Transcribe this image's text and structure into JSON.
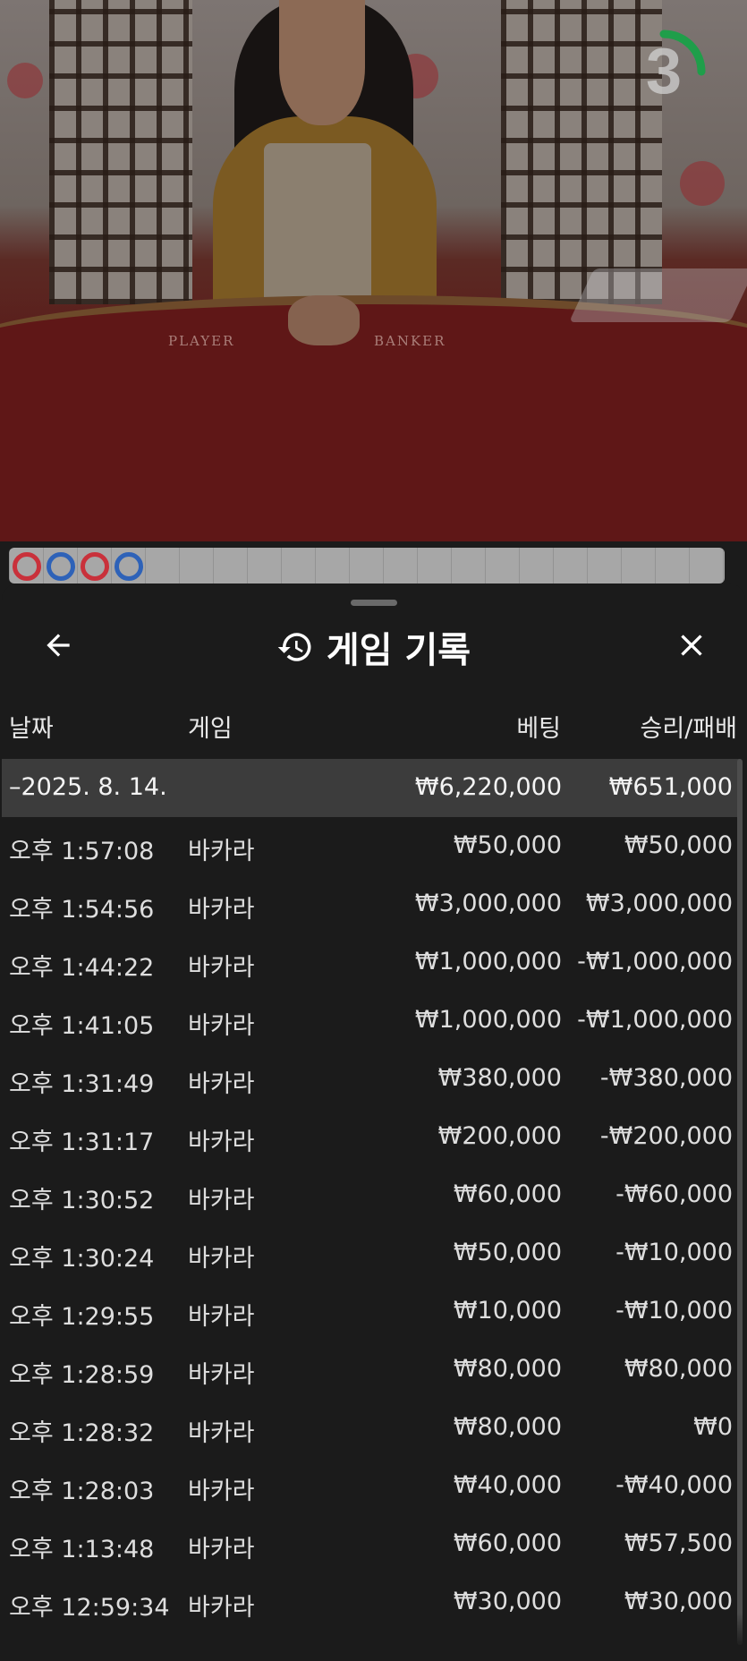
{
  "video": {
    "table_labels": [
      "PLAYER",
      "BANKER"
    ],
    "countdown": "3",
    "countdown_color": "#1f9e4a"
  },
  "road": {
    "beads": [
      "banker",
      "player",
      "banker",
      "player"
    ],
    "colors": {
      "banker": "#c9313b",
      "player": "#2e62b8"
    }
  },
  "history": {
    "title": "게임 기록",
    "icons": {
      "back": "arrow-left-icon",
      "title": "history-clock-icon",
      "close": "close-x-icon"
    },
    "columns": {
      "date": "날짜",
      "game": "게임",
      "bet": "베팅",
      "result": "승리/패배"
    },
    "summary": {
      "date": "–2025. 8. 14.",
      "bet": "₩6,220,000",
      "result": "₩651,000"
    },
    "rows": [
      {
        "time": "오후 1:57:08",
        "game": "바카라",
        "bet": "₩50,000",
        "result": "₩50,000"
      },
      {
        "time": "오후 1:54:56",
        "game": "바카라",
        "bet": "₩3,000,000",
        "result": "₩3,000,000"
      },
      {
        "time": "오후 1:44:22",
        "game": "바카라",
        "bet": "₩1,000,000",
        "result": "-₩1,000,000"
      },
      {
        "time": "오후 1:41:05",
        "game": "바카라",
        "bet": "₩1,000,000",
        "result": "-₩1,000,000"
      },
      {
        "time": "오후 1:31:49",
        "game": "바카라",
        "bet": "₩380,000",
        "result": "-₩380,000"
      },
      {
        "time": "오후 1:31:17",
        "game": "바카라",
        "bet": "₩200,000",
        "result": "-₩200,000"
      },
      {
        "time": "오후 1:30:52",
        "game": "바카라",
        "bet": "₩60,000",
        "result": "-₩60,000"
      },
      {
        "time": "오후 1:30:24",
        "game": "바카라",
        "bet": "₩50,000",
        "result": "-₩10,000"
      },
      {
        "time": "오후 1:29:55",
        "game": "바카라",
        "bet": "₩10,000",
        "result": "-₩10,000"
      },
      {
        "time": "오후 1:28:59",
        "game": "바카라",
        "bet": "₩80,000",
        "result": "₩80,000"
      },
      {
        "time": "오후 1:28:32",
        "game": "바카라",
        "bet": "₩80,000",
        "result": "₩0"
      },
      {
        "time": "오후 1:28:03",
        "game": "바카라",
        "bet": "₩40,000",
        "result": "-₩40,000"
      },
      {
        "time": "오후 1:13:48",
        "game": "바카라",
        "bet": "₩60,000",
        "result": "₩57,500"
      },
      {
        "time": "오후 12:59:34",
        "game": "바카라",
        "bet": "₩30,000",
        "result": "₩30,000"
      }
    ]
  }
}
